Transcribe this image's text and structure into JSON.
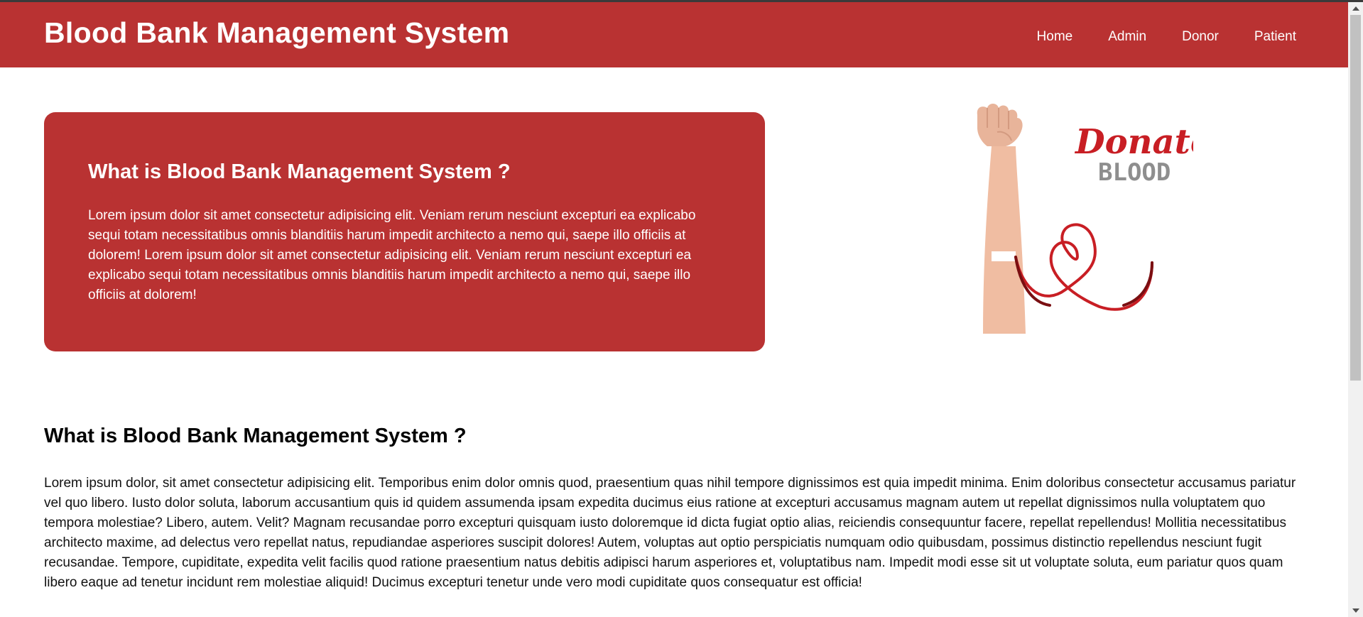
{
  "navbar": {
    "brand": "Blood Bank Management System",
    "links": [
      "Home",
      "Admin",
      "Donor",
      "Patient"
    ]
  },
  "hero": {
    "title": "What is Blood Bank Management System ?",
    "text": "Lorem ipsum dolor sit amet consectetur adipisicing elit. Veniam rerum nesciunt excepturi ea explicabo sequi totam necessitatibus omnis blanditiis harum impedit architecto a nemo qui, saepe illo officiis at dolorem! Lorem ipsum dolor sit amet consectetur adipisicing elit. Veniam rerum nesciunt excepturi ea explicabo sequi totam necessitatibus omnis blanditiis harum impedit architecto a nemo qui, saepe illo officiis at dolorem!",
    "art": {
      "word1": "Donate",
      "word2": "BLOOD"
    }
  },
  "section": {
    "title": "What is Blood Bank Management System ?",
    "text": "Lorem ipsum dolor, sit amet consectetur adipisicing elit. Temporibus enim dolor omnis quod, praesentium quas nihil tempore dignissimos est quia impedit minima. Enim doloribus consectetur accusamus pariatur vel quo libero. Iusto dolor soluta, laborum accusantium quis id quidem assumenda ipsam expedita ducimus eius ratione at excepturi accusamus magnam autem ut repellat dignissimos nulla voluptatem quo tempora molestiae? Libero, autem. Velit? Magnam recusandae porro excepturi quisquam iusto doloremque id dicta fugiat optio alias, reiciendis consequuntur facere, repellat repellendus! Mollitia necessitatibus architecto maxime, ad delectus vero repellat natus, repudiandae asperiores suscipit dolores! Autem, voluptas aut optio perspiciatis numquam odio quibusdam, possimus distinctio repellendus nesciunt fugit recusandae. Tempore, cupiditate, expedita velit facilis quod ratione praesentium natus debitis adipisci harum asperiores et, voluptatibus nam. Impedit modi esse sit ut voluptate soluta, eum pariatur quos quam libero eaque ad tenetur incidunt rem molestiae aliquid! Ducimus excepturi tenetur unde vero modi cupiditate quos consequatur est officia!"
  },
  "colors": {
    "primary": "#b93232",
    "text": "#111111",
    "background": "#ffffff"
  }
}
